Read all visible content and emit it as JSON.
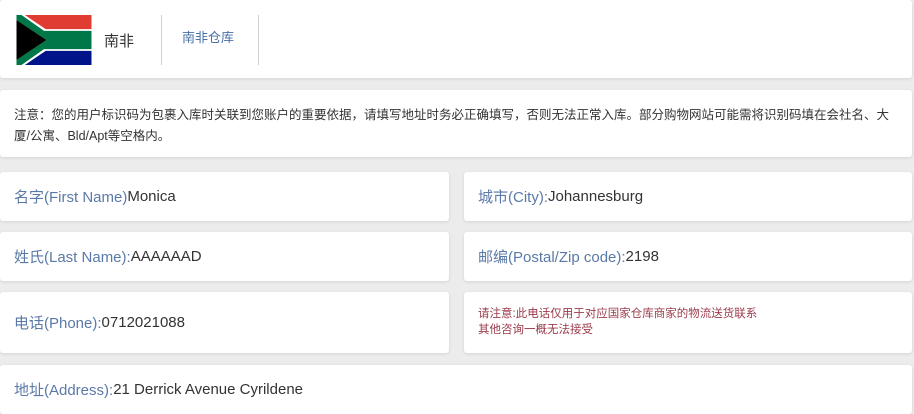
{
  "header": {
    "country_name": "南非",
    "tabs": [
      {
        "label": "南非仓库"
      }
    ]
  },
  "notice": {
    "text": "注意：您的用户标识码为包裹入库时关联到您账户的重要依据，请填写地址时务必正确填写，否则无法正常入库。部分购物网站可能需将识别码填在会社名、大厦/公寓、Bld/Apt等空格内。"
  },
  "fields": {
    "first_name": {
      "label": "名字(First Name)",
      "value": "Monica"
    },
    "city": {
      "label": "城市(City):",
      "value": "Johannesburg"
    },
    "last_name": {
      "label": "姓氏(Last Name):",
      "value": "AAAAAAD"
    },
    "zip": {
      "label": "邮编(Postal/Zip code):",
      "value": "2198"
    },
    "phone": {
      "label": "电话(Phone):",
      "value": "0712021088"
    },
    "address": {
      "label": "地址(Address):",
      "value": "21 Derrick Avenue Cyrildene"
    }
  },
  "phone_note": {
    "line1": "请注意:此电话仅用于对应国家仓库商家的物流送货联系",
    "line2": "其他咨询一概无法接受"
  },
  "colors": {
    "label": "#5b79a8",
    "note": "#9b3b4b",
    "tab": "#4a6fa5"
  },
  "icons": {
    "flag": "south-africa-flag-icon"
  }
}
